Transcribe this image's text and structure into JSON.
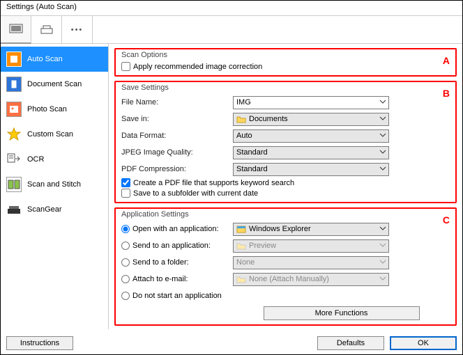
{
  "window": {
    "title": "Settings (Auto Scan)"
  },
  "sidebar": {
    "items": [
      {
        "label": "Auto Scan"
      },
      {
        "label": "Document Scan"
      },
      {
        "label": "Photo Scan"
      },
      {
        "label": "Custom Scan"
      },
      {
        "label": "OCR"
      },
      {
        "label": "Scan and Stitch"
      },
      {
        "label": "ScanGear"
      }
    ]
  },
  "sections": {
    "scanOptions": {
      "legend": "Scan Options",
      "annot": "A",
      "applyCorrection": "Apply recommended image correction"
    },
    "saveSettings": {
      "legend": "Save Settings",
      "annot": "B",
      "fileNameLabel": "File Name:",
      "fileNameValue": "IMG",
      "saveInLabel": "Save in:",
      "saveInValue": "Documents",
      "dataFormatLabel": "Data Format:",
      "dataFormatValue": "Auto",
      "jpegLabel": "JPEG Image Quality:",
      "jpegValue": "Standard",
      "pdfLabel": "PDF Compression:",
      "pdfValue": "Standard",
      "keywordSearch": "Create a PDF file that supports keyword search",
      "subfolder": "Save to a subfolder with current date"
    },
    "appSettings": {
      "legend": "Application Settings",
      "annot": "C",
      "openWith": "Open with an application:",
      "openWithValue": "Windows Explorer",
      "sendApp": "Send to an application:",
      "sendAppValue": "Preview",
      "sendFolder": "Send to a folder:",
      "sendFolderValue": "None",
      "attach": "Attach to e-mail:",
      "attachValue": "None (Attach Manually)",
      "doNotStart": "Do not start an application",
      "moreFunctions": "More Functions"
    }
  },
  "footer": {
    "instructions": "Instructions",
    "defaults": "Defaults",
    "ok": "OK"
  }
}
